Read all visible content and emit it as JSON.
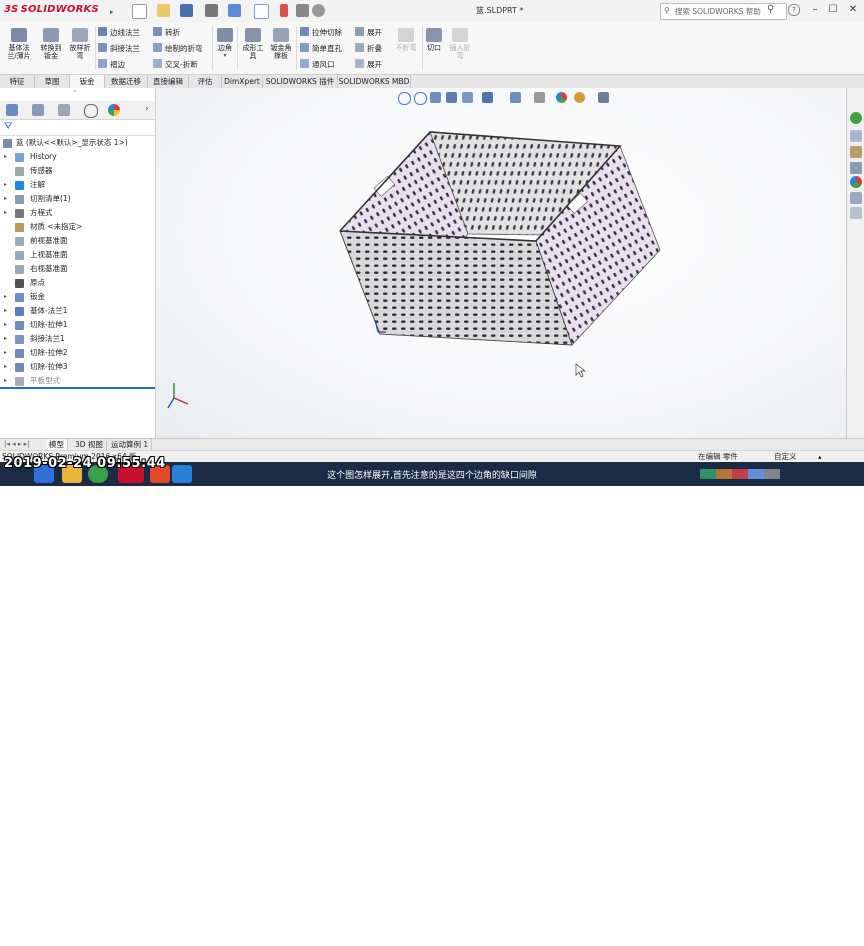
{
  "app": {
    "logo_text": "SOLIDWORKS",
    "doc_title": "篮.SLDPRT *"
  },
  "search": {
    "placeholder": "搜索 SOLIDWORKS 帮助"
  },
  "commands": {
    "big": [
      {
        "id": "base-flange",
        "label": "基体法\n兰/薄片"
      },
      {
        "id": "convert-to-sheet",
        "label": "转换到\n钣金"
      },
      {
        "id": "lofted-bend",
        "label": "放样折\n弯"
      },
      {
        "id": "corner",
        "label": "边角"
      },
      {
        "id": "forming-tool",
        "label": "成形工\n具"
      },
      {
        "id": "sheet-gusset",
        "label": "钣金角\n撑板"
      },
      {
        "id": "no-bends",
        "label": "不折弯"
      },
      {
        "id": "cut",
        "label": "切口"
      },
      {
        "id": "insert-bends",
        "label": "插入折\n弯"
      }
    ],
    "small": [
      {
        "id": "edge-flange",
        "label": "边线法兰"
      },
      {
        "id": "miter-flange",
        "label": "斜接法兰"
      },
      {
        "id": "hem",
        "label": "褶边"
      },
      {
        "id": "jog",
        "label": "转折"
      },
      {
        "id": "sketched-bend",
        "label": "绘制的折弯"
      },
      {
        "id": "cross-break",
        "label": "交叉-折断"
      },
      {
        "id": "extruded-cut",
        "label": "拉伸切除"
      },
      {
        "id": "simple-hole",
        "label": "简单直孔"
      },
      {
        "id": "vent",
        "label": "通风口"
      },
      {
        "id": "unfold",
        "label": "展开"
      },
      {
        "id": "fold",
        "label": "折叠"
      },
      {
        "id": "flatten",
        "label": "展开"
      }
    ]
  },
  "tabs": [
    "特征",
    "草图",
    "钣金",
    "数据迁移",
    "直接编辑",
    "评估",
    "DimXpert",
    "SOLIDWORKS 插件",
    "SOLIDWORKS MBD"
  ],
  "active_tab": "钣金",
  "tree": {
    "root": "篮 (默认<<默认>_显示状态 1>)",
    "items": [
      {
        "label": "History",
        "expand": "▸"
      },
      {
        "label": "传感器",
        "expand": ""
      },
      {
        "label": "注解",
        "expand": "▸"
      },
      {
        "label": "切割清单(1)",
        "expand": "▸"
      },
      {
        "label": "方程式",
        "expand": "▸"
      },
      {
        "label": "材质 <未指定>",
        "expand": ""
      },
      {
        "label": "前视基准面",
        "expand": ""
      },
      {
        "label": "上视基准面",
        "expand": ""
      },
      {
        "label": "右视基准面",
        "expand": ""
      },
      {
        "label": "原点",
        "expand": ""
      },
      {
        "label": "钣金",
        "expand": "▸"
      },
      {
        "label": "基体-法兰1",
        "expand": "▸"
      },
      {
        "label": "切除-拉伸1",
        "expand": "▸"
      },
      {
        "label": "斜接法兰1",
        "expand": "▸"
      },
      {
        "label": "切除-拉伸2",
        "expand": "▸"
      },
      {
        "label": "切除-拉伸3",
        "expand": "▸"
      },
      {
        "label": "平板型式",
        "expand": "▸"
      }
    ]
  },
  "bottom_tabs": [
    "模型",
    "3D 视图",
    "运动算例 1"
  ],
  "status": {
    "left": "SOLIDWORKS Premium 2016 x64 版",
    "mode": "在编辑 零件",
    "custom": "自定义"
  },
  "taskbar": {
    "caption": "这个图怎样展开,首先注意的是这四个边角的缺口间隙",
    "time": "9:55",
    "date": "2019/2/24",
    "overlay_timestamp": "2019-02-24 09:55:44"
  },
  "colors": {
    "accent": "#1f6fc5",
    "brand": "#c8102e",
    "taskbar": "#1b2a45",
    "sheet_side": "#e8dff0",
    "sheet_front": "#d8d8da"
  }
}
